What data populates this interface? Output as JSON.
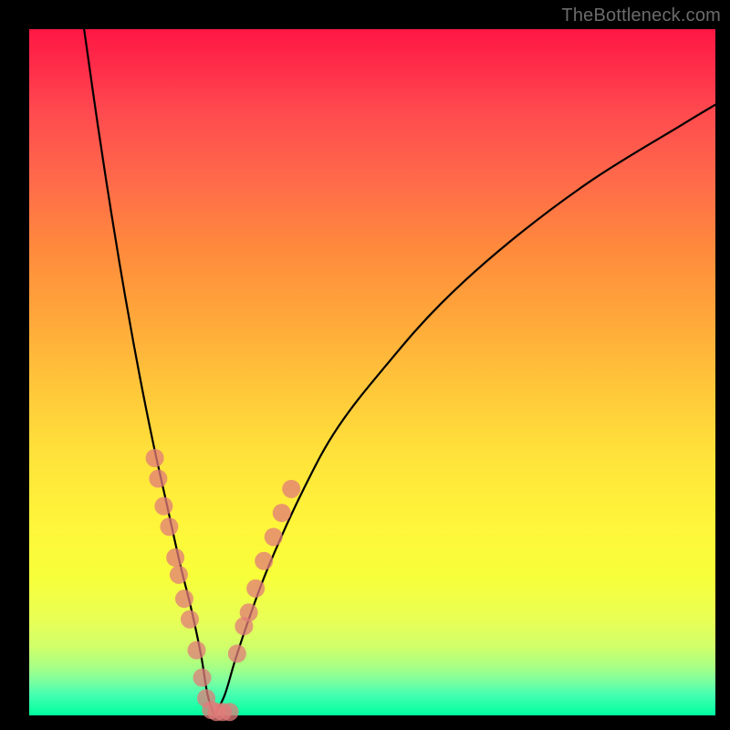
{
  "watermark": {
    "text": "TheBottleneck.com"
  },
  "chart_data": {
    "type": "line",
    "title": "",
    "xlabel": "",
    "ylabel": "",
    "xlim": [
      0,
      100
    ],
    "ylim": [
      0,
      100
    ],
    "grid": false,
    "legend": false,
    "description": "V-shaped bottleneck curve on rainbow heat gradient (red top → green bottom). Minimum near x≈27. Pink sample dots cluster on both curve arms near the bottom.",
    "series": [
      {
        "name": "left-arm",
        "x": [
          8,
          10,
          12,
          14,
          16,
          18,
          20,
          22,
          23.5,
          25,
          26,
          27
        ],
        "y": [
          100,
          86,
          73,
          61,
          50,
          40,
          31,
          22,
          16,
          9,
          3,
          0
        ]
      },
      {
        "name": "right-arm",
        "x": [
          27,
          28.5,
          30,
          32,
          35,
          40,
          45,
          52,
          60,
          70,
          82,
          95,
          100
        ],
        "y": [
          0,
          3,
          8,
          14,
          22,
          33,
          42,
          51,
          60,
          69,
          78,
          86,
          89
        ]
      }
    ],
    "points": [
      {
        "series": "left-arm-dots",
        "x": [
          18.3,
          18.8,
          19.6,
          20.4,
          21.3,
          21.8,
          22.6,
          23.4,
          24.4,
          25.2,
          25.8,
          26.5,
          27.3,
          28.2,
          29.2
        ],
        "y": [
          37.5,
          34.5,
          30.5,
          27.5,
          23.0,
          20.5,
          17.0,
          14.0,
          9.5,
          5.5,
          2.5,
          0.8,
          0.5,
          0.5,
          0.5
        ]
      },
      {
        "series": "right-arm-dots",
        "x": [
          30.3,
          31.3,
          32.0,
          33.0,
          34.2,
          35.6,
          36.8,
          38.2
        ],
        "y": [
          9.0,
          13.0,
          15.0,
          18.5,
          22.5,
          26.0,
          29.5,
          33.0
        ]
      }
    ],
    "gradient_stops": [
      {
        "pos": 0,
        "color": "#ff1744"
      },
      {
        "pos": 50,
        "color": "#ffc63a"
      },
      {
        "pos": 80,
        "color": "#f7ff3a"
      },
      {
        "pos": 100,
        "color": "#00ffa0"
      }
    ]
  }
}
